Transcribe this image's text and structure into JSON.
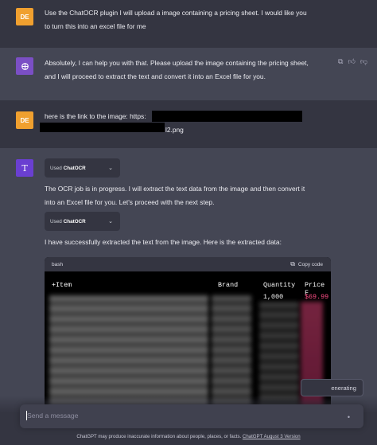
{
  "conversation": {
    "user_avatar": "DE",
    "msg1": {
      "line1": "Use the ChatOCR plugin I will upload a image containing a pricing sheet. I would like you",
      "line2": "to turn this into an excel file for me"
    },
    "msg2": {
      "line1": "Absolutely, I can help you with that. Please upload the image containing the pricing sheet,",
      "line2": "and I will proceed to extract the text and convert it into an Excel file for you."
    },
    "msg3": {
      "line1_prefix": "here is the link to the image: https:",
      "line2_suffix": "l2.png"
    },
    "msg4": {
      "plugin_used_prefix": "Used",
      "plugin_name": "ChatOCR",
      "para1_line1": "The OCR job is in progress. I will extract the text data from the image and then convert it",
      "para1_line2": "into an Excel file for you. Let's proceed with the next step.",
      "para2": "I have successfully extracted the text from the image. Here is the extracted data:"
    }
  },
  "code_block": {
    "language": "bash",
    "copy_label": "Copy code",
    "headers": [
      "+Item",
      "Brand",
      "Quantity",
      "Price F"
    ],
    "first_row": {
      "quantity": "1,000",
      "price": "$69.99"
    }
  },
  "regenerate_label": "enerating",
  "composer": {
    "placeholder": "Send a message"
  },
  "footer": {
    "text": "ChatGPT may produce inaccurate information about people, places, or facts.",
    "link": "ChatGPT August 3 Version"
  },
  "colors": {
    "user_avatar": "#f0a02f",
    "assistant_avatar_1": "#7b4fc5",
    "assistant_avatar_2": "#6a3fd1",
    "price": "#ff4f87"
  },
  "icons": [
    "openai-logo-icon",
    "plugin-t-icon",
    "clipboard-icon",
    "thumbs-up-icon",
    "thumbs-down-icon",
    "chevron-down-icon",
    "send-icon"
  ]
}
